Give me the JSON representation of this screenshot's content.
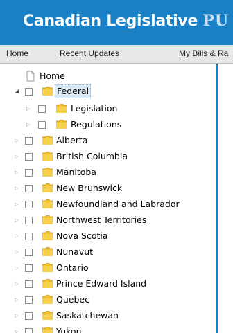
{
  "header": {
    "title_main": "Canadian Legislative",
    "title_accent": "PU"
  },
  "nav": {
    "items": [
      "Home",
      "Recent Updates",
      "My Bills & Ra"
    ]
  },
  "tree": {
    "home": "Home",
    "federal": "Federal",
    "federal_children": [
      "Legislation",
      "Regulations"
    ],
    "provinces": [
      "Alberta",
      "British Columbia",
      "Manitoba",
      "New Brunswick",
      "Newfoundland and Labrador",
      "Northwest Territories",
      "Nova Scotia",
      "Nunavut",
      "Ontario",
      "Prince Edward Island",
      "Quebec",
      "Saskatchewan",
      "Yukon"
    ]
  },
  "colors": {
    "banner": "#1a80c6",
    "folder": "#f2c230"
  }
}
